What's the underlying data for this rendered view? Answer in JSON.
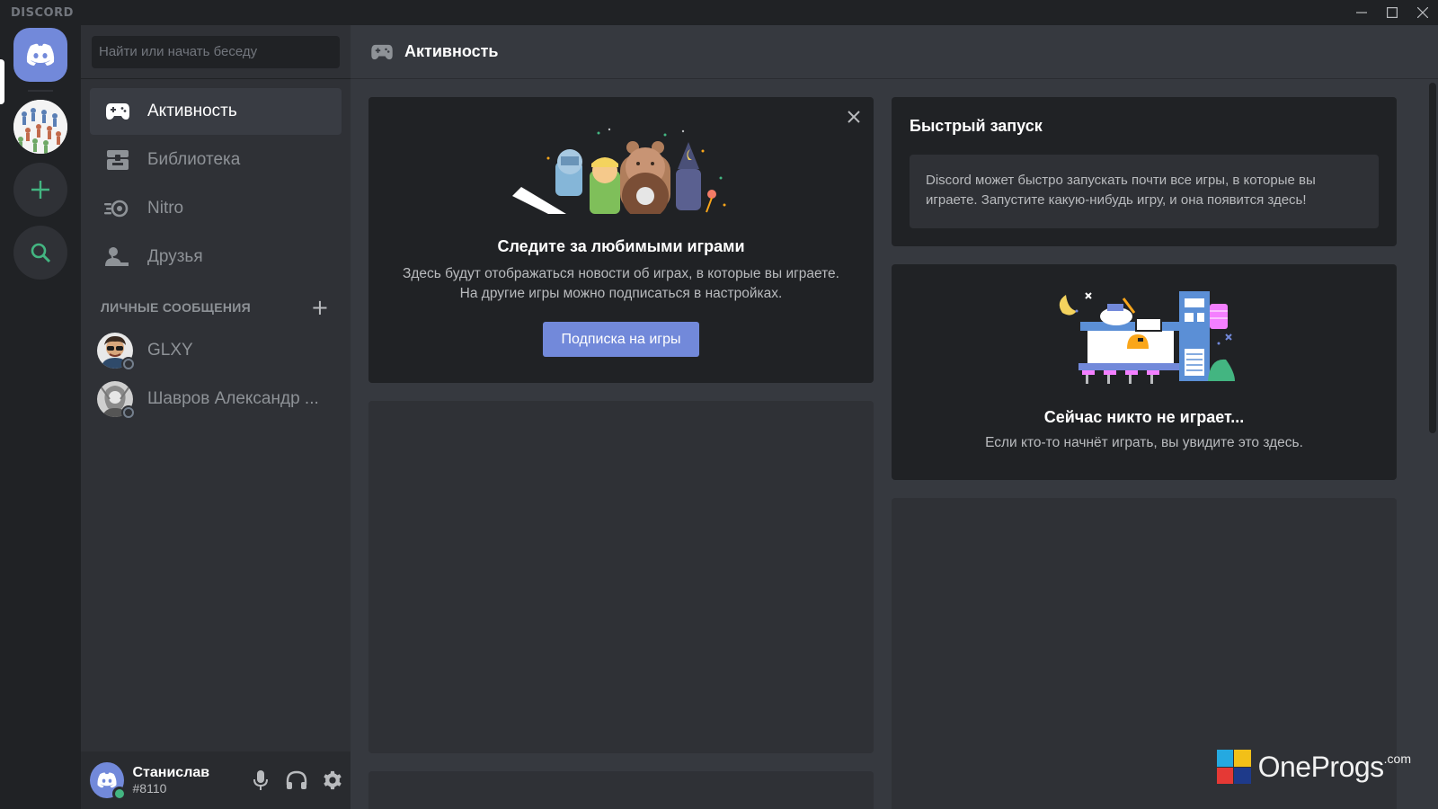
{
  "app": {
    "wordmark": "DISCORD"
  },
  "icons": {
    "home": "discord-logo-icon",
    "add_server": "plus-icon",
    "explore": "search-icon",
    "activity": "gamepad-icon",
    "library": "library-icon",
    "nitro": "nitro-icon",
    "friends": "friends-icon",
    "mic": "microphone-icon",
    "headset": "headphones-icon",
    "settings": "gear-icon"
  },
  "colors": {
    "accent": "#7289da",
    "online": "#43b581",
    "add_green": "#43b581"
  },
  "sidebar": {
    "search_placeholder": "Найти или начать беседу",
    "nav": [
      {
        "label": "Активность"
      },
      {
        "label": "Библиотека"
      },
      {
        "label": "Nitro"
      },
      {
        "label": "Друзья"
      }
    ],
    "dm_header": "ЛИЧНЫЕ СООБЩЕНИЯ",
    "dm_add": "+",
    "dms": [
      {
        "name": "GLXY"
      },
      {
        "name": "Шавров Александр ..."
      }
    ]
  },
  "user": {
    "name": "Станислав",
    "tag": "#8110"
  },
  "main": {
    "title": "Активность",
    "follow_card": {
      "title": "Следите за любимыми играми",
      "desc_line1": "Здесь будут отображаться новости об играх, в которые вы играете.",
      "desc_line2": "На другие игры можно подписаться в настройках.",
      "button": "Подписка на игры"
    },
    "quick_launch": {
      "title": "Быстрый запуск",
      "text": "Discord может быстро запускать почти все игры, в которые вы играете. Запустите какую-нибудь игру, и она появится здесь!"
    },
    "now_playing": {
      "title": "Сейчас никто не играет...",
      "desc": "Если кто-то начнёт играть, вы увидите это здесь."
    }
  },
  "watermark": {
    "text": "OneProgs",
    "sup": ".com"
  }
}
